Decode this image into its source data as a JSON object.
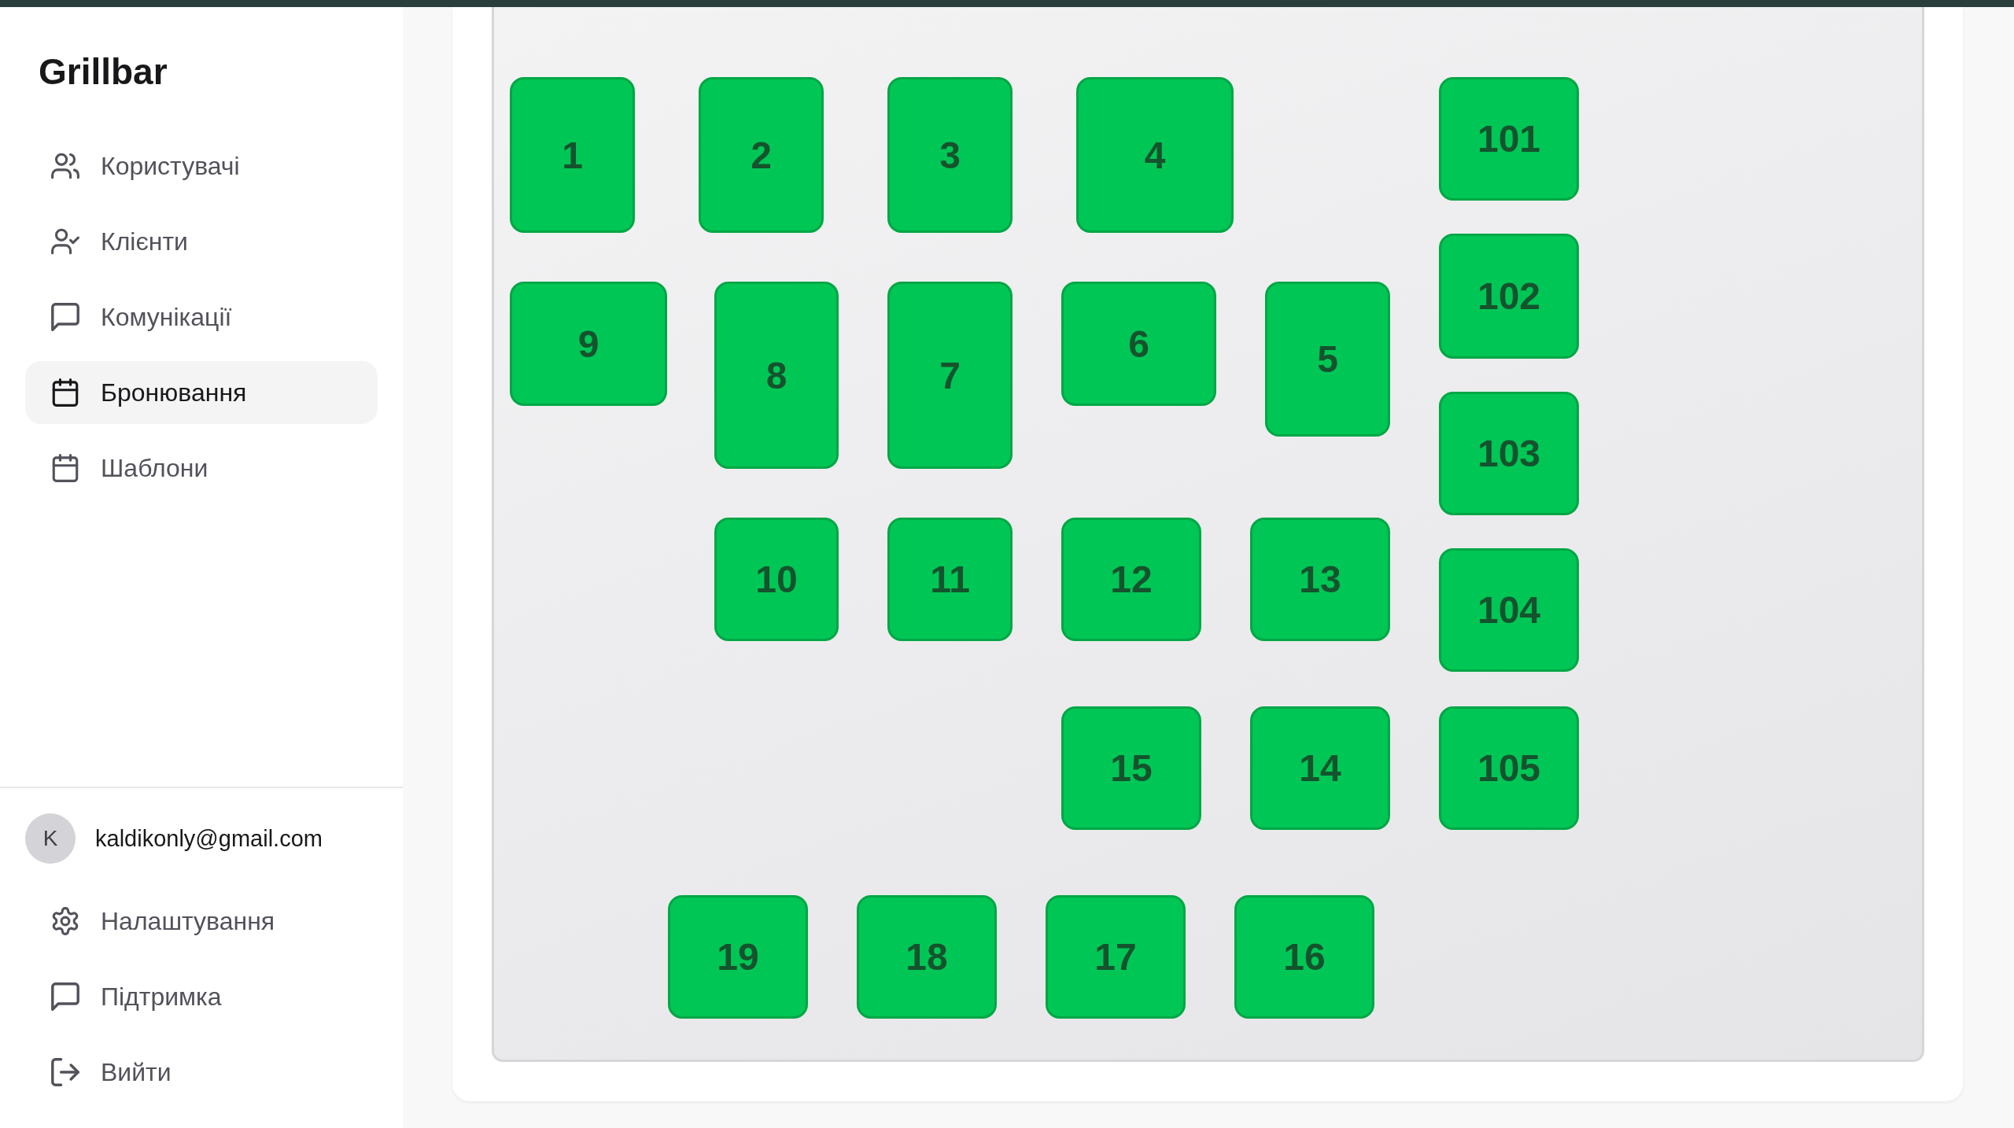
{
  "sidebar": {
    "brand": "Grillbar",
    "nav_items": [
      {
        "label": "Користувачі",
        "selected": false
      },
      {
        "label": "Клієнти",
        "selected": false
      },
      {
        "label": "Комунікації",
        "selected": false
      },
      {
        "label": "Бронювання",
        "selected": true
      },
      {
        "label": "Шаблони",
        "selected": false
      }
    ],
    "account": {
      "avatar_initial": "K",
      "email": "kaldikonly@gmail.com"
    },
    "footer_items": [
      {
        "label": "Налаштування"
      },
      {
        "label": "Підтримка"
      },
      {
        "label": "Вийти"
      }
    ]
  },
  "floor_plan": {
    "tables": [
      {
        "label": "1"
      },
      {
        "label": "2"
      },
      {
        "label": "3"
      },
      {
        "label": "4"
      },
      {
        "label": "101"
      },
      {
        "label": "9"
      },
      {
        "label": "8"
      },
      {
        "label": "7"
      },
      {
        "label": "6"
      },
      {
        "label": "5"
      },
      {
        "label": "102"
      },
      {
        "label": "103"
      },
      {
        "label": "10"
      },
      {
        "label": "11"
      },
      {
        "label": "12"
      },
      {
        "label": "13"
      },
      {
        "label": "104"
      },
      {
        "label": "15"
      },
      {
        "label": "14"
      },
      {
        "label": "105"
      },
      {
        "label": "19"
      },
      {
        "label": "18"
      },
      {
        "label": "17"
      },
      {
        "label": "16"
      }
    ]
  }
}
